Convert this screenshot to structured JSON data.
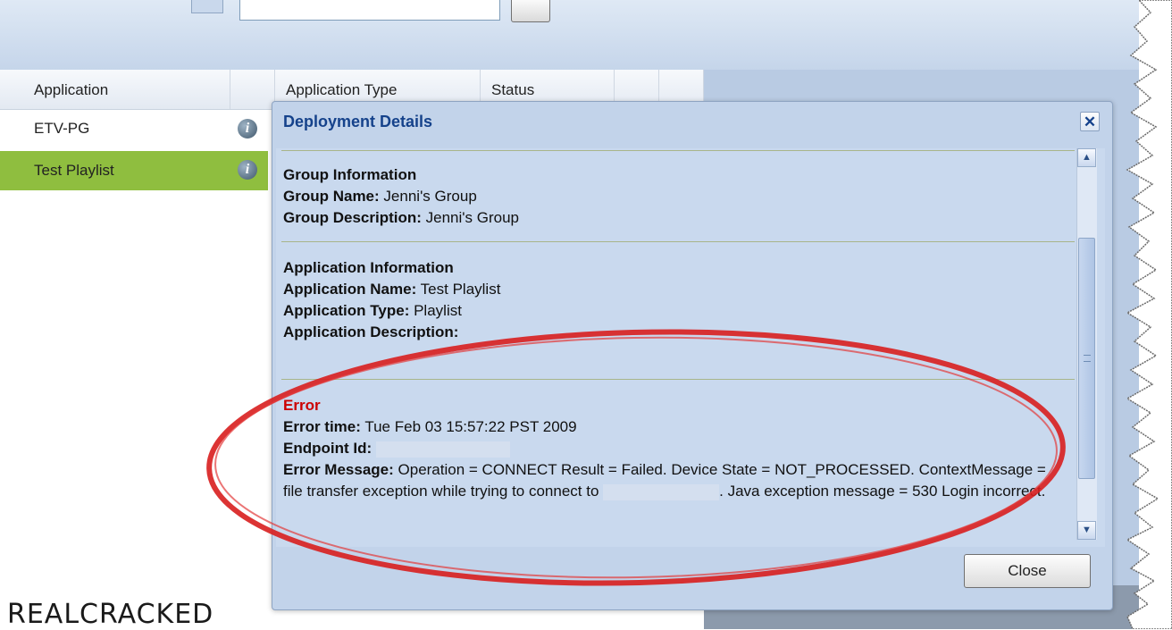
{
  "grid": {
    "columns": [
      "Application",
      "Application Type",
      "Status"
    ],
    "rows": [
      {
        "name": "ETV-PG",
        "selected": false
      },
      {
        "name": "Test Playlist",
        "selected": true
      }
    ],
    "info_icon_glyph": "i"
  },
  "dialog": {
    "title": "Deployment Details",
    "close_x": "✕",
    "close_button": "Close",
    "group": {
      "heading": "Group Information",
      "name_label": "Group Name:",
      "name_value": "Jenni's Group",
      "description_label": "Group Description:",
      "description_value": "Jenni's Group"
    },
    "application": {
      "heading": "Application Information",
      "name_label": "Application Name:",
      "name_value": "Test Playlist",
      "type_label": "Application Type:",
      "type_value": "Playlist",
      "description_label": "Application Description:"
    },
    "error": {
      "heading": "Error",
      "time_label": "Error time:",
      "time_value": "Tue Feb 03 15:57:22 PST 2009",
      "endpoint_label": "Endpoint Id:",
      "message_label": "Error Message:",
      "message_part1": "Operation = CONNECT Result = Failed. Device State = NOT_PROCESSED. ContextMessage = file transfer exception while trying to connect to",
      "message_part2": ". Java exception message = 530 Login incorrect."
    },
    "scroll": {
      "up_glyph": "▲",
      "down_glyph": "▼"
    }
  },
  "watermark": "REALCRACKED",
  "colors": {
    "selected_row": "#8fbe3f",
    "error_heading": "#cc0000",
    "annotation_ellipse": "#d81e1e",
    "dialog_title": "#15428b"
  }
}
